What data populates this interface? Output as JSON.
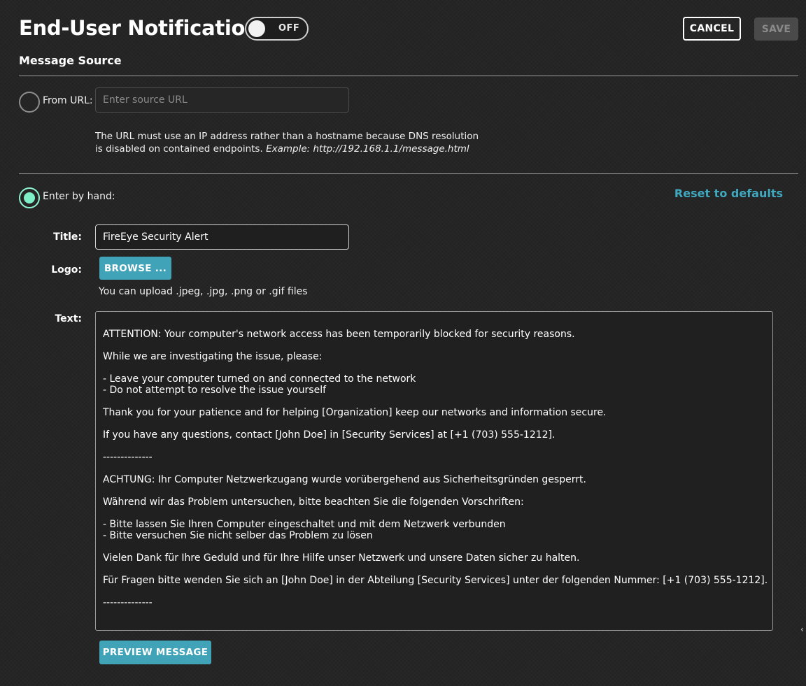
{
  "header": {
    "title": "End-User Notification",
    "toggle_state": "OFF",
    "cancel_label": "CANCEL",
    "save_label": "SAVE"
  },
  "message_source": {
    "heading": "Message Source",
    "from_url": {
      "label": "From URL:",
      "selected": false,
      "placeholder": "Enter source URL",
      "help_line1": "The URL must use an IP address rather than a hostname because DNS resolution",
      "help_line2_plain": "is disabled on contained endpoints. ",
      "help_line2_example": "Example: http://192.168.1.1/message.html"
    },
    "by_hand": {
      "label": "Enter by hand:",
      "selected": true,
      "reset_label": "Reset to defaults"
    }
  },
  "form": {
    "title_label": "Title:",
    "title_value": "FireEye Security Alert",
    "logo_label": "Logo:",
    "browse_label": "BROWSE ...",
    "upload_hint": "You can upload .jpeg, .jpg, .png or .gif files",
    "text_label": "Text:",
    "text_lines": [
      "ATTENTION: Your computer's network access has been temporarily blocked for security reasons.",
      "",
      "While we are investigating the issue, please:",
      "",
      "- Leave your computer turned on and connected to the network",
      "- Do not attempt to resolve the issue yourself",
      "",
      "Thank you for your patience and for helping [Organization] keep our networks and information secure.",
      "",
      "If you have any questions, contact [John Doe] in [Security Services] at [+1 (703) 555-1212].",
      "",
      "--------------",
      "",
      "ACHTUNG: Ihr Computer Netzwerkzugang wurde vorübergehend aus Sicherheitsgründen gesperrt.",
      "",
      "Während wir das Problem untersuchen, bitte beachten Sie die folgenden Vorschriften:",
      "",
      "- Bitte lassen Sie Ihren Computer eingeschaltet und mit dem Netzwerk verbunden",
      "- Bitte versuchen Sie nicht selber das Problem zu lösen",
      "",
      "Vielen Dank für Ihre Geduld und für Ihre Hilfe unser Netzwerk und unsere Daten sicher zu halten.",
      "",
      "Für Fragen bitte wenden Sie sich an [John Doe] in der Abteilung [Security Services] unter der folgenden Nummer: [+1 (703) 555-1212].",
      "",
      "--------------"
    ],
    "preview_label": "PREVIEW MESSAGE"
  },
  "colors": {
    "background": "#232323",
    "accent_teal": "#41a3b8",
    "reset_link": "#3fa9c0",
    "radio_selected": "#7ef0c8"
  },
  "icons": {
    "resize_handle": "resize-handle-icon"
  }
}
